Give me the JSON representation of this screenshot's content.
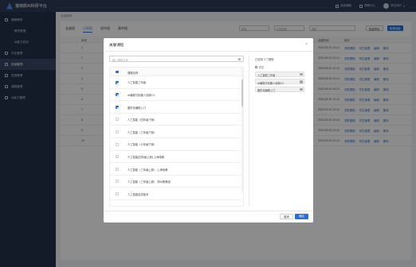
{
  "app": {
    "title": "猫咖数AI科研平台"
  },
  "header": {
    "items": [
      {
        "label": "系统通知"
      },
      {
        "label": "帮助中心"
      }
    ],
    "user": "学生用户"
  },
  "sidebar": {
    "items": [
      {
        "label": "课程教研",
        "active": false,
        "sub": false,
        "chevron": true
      },
      {
        "label": "教学数据",
        "active": false,
        "sub": true
      },
      {
        "label": "AI能力应用",
        "active": false,
        "sub": true
      },
      {
        "label": "作业管理",
        "active": false,
        "sub": false
      },
      {
        "label": "班级管理",
        "active": true,
        "sub": false
      },
      {
        "label": "资源管理",
        "active": false,
        "sub": false
      },
      {
        "label": "课程管理",
        "active": false,
        "sub": false
      },
      {
        "label": "AI能力管理",
        "active": false,
        "sub": false
      }
    ]
  },
  "main": {
    "breadcrumb": "班级管理",
    "tabs": [
      {
        "label": "全部班"
      },
      {
        "label": "小学班",
        "active": true
      },
      {
        "label": "初中班"
      },
      {
        "label": "高中班"
      }
    ],
    "filters": {
      "grade": "年级",
      "status": "状态选择",
      "search": "搜索"
    },
    "batch_label": "批量导出",
    "new_label": "新增班级",
    "columns": {
      "num": "序号",
      "time": "创建时间",
      "ops": "操作"
    },
    "rows": [
      {
        "num": "1",
        "time": "2023-09-01 10:14",
        "ops": [
          "关联课程",
          "学生管理",
          "编辑",
          "删除"
        ]
      },
      {
        "num": "2",
        "time": "2023-09-01 10:14",
        "ops": [
          "关联课程",
          "学生管理",
          "编辑",
          "删除"
        ]
      },
      {
        "num": "3",
        "time": "2023-09-01 10:14",
        "ops": [
          "关联课程",
          "学生管理",
          "编辑",
          "删除"
        ]
      },
      {
        "num": "4",
        "time": "2023-09-01 10:14",
        "ops": [
          "关联课程",
          "学生管理",
          "编辑",
          "删除"
        ]
      },
      {
        "num": "5",
        "time": "2023-09-01 10:14",
        "ops": [
          "关联课程",
          "学生管理",
          "编辑",
          "删除"
        ]
      },
      {
        "num": "6",
        "time": "2023-09-01 10:14",
        "ops": [
          "关联课程",
          "学生管理",
          "编辑",
          "删除"
        ]
      },
      {
        "num": "7",
        "time": "2023-09-01 10:14",
        "ops": [
          "关联课程",
          "学生管理",
          "编辑",
          "删除"
        ]
      },
      {
        "num": "8",
        "time": "2023-09-01 10:14",
        "ops": [
          "关联课程",
          "学生管理",
          "编辑",
          "删除"
        ]
      },
      {
        "num": "9",
        "time": "2023-09-01 10:14",
        "ops": [
          "关联课程",
          "学生管理",
          "编辑",
          "删除"
        ]
      },
      {
        "num": "10",
        "time": "2023-09-01 10:14",
        "ops": [
          "关联课程",
          "学生管理",
          "编辑",
          "删除"
        ]
      }
    ]
  },
  "modal": {
    "title": "关联课程",
    "close": "×",
    "search_placeholder": "输入课程名称",
    "list_header": "课程名称",
    "courses": [
      {
        "name": "人工智能三年级",
        "checked": true
      },
      {
        "name": "AI编程与机器人创新2.0",
        "checked": true
      },
      {
        "name": "图形化编程入门",
        "checked": true
      },
      {
        "name": "人工智能（四年级下册）",
        "checked": false
      },
      {
        "name": "人工智能（三年级下册）",
        "checked": false
      },
      {
        "name": "人工智能（七年级下册）",
        "checked": false
      },
      {
        "name": "人工智能(四年级上册)-上海电教",
        "checked": false
      },
      {
        "name": "人工智能（三年级上册）-上海电教",
        "checked": false
      },
      {
        "name": "人工智能（三年级上册）-郑州职教版",
        "checked": false
      },
      {
        "name": "人工智能启蒙版本",
        "checked": false
      }
    ],
    "selected_count": "已选择 3 门课程",
    "clear_label": "清空",
    "selected": [
      {
        "name": "人工智能三年级"
      },
      {
        "name": "AI编程与机器人创新2.0"
      },
      {
        "name": "图形化编程入门"
      }
    ],
    "cancel_label": "取消",
    "ok_label": "确定"
  }
}
